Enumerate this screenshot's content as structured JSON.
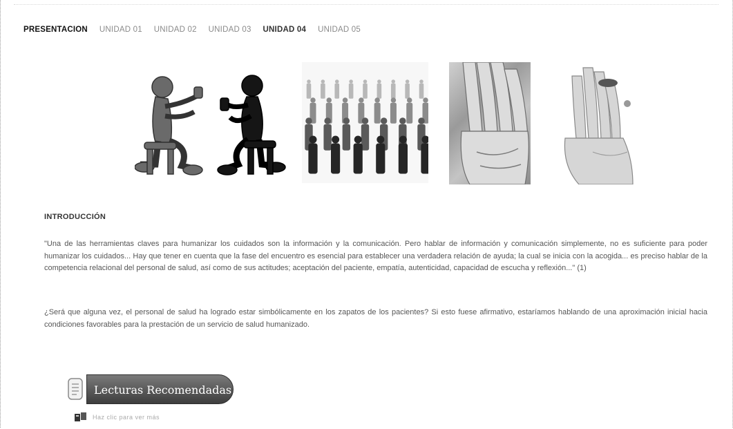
{
  "tabs": [
    {
      "label": "PRESENTACION"
    },
    {
      "label": "UNIDAD 01"
    },
    {
      "label": "UNIDAD 02"
    },
    {
      "label": "UNIDAD 03"
    },
    {
      "label": "UNIDAD 04"
    },
    {
      "label": "UNIDAD 05"
    }
  ],
  "intro": {
    "heading": "INTRODUCCIÓN",
    "paragraph1": "\"Una de las herramientas claves para humanizar los cuidados son la información y la comunicación. Pero hablar de información y comunicación simplemente, no es suficiente para poder humanizar los cuidados... Hay que tener en cuenta que la fase del encuentro es esencial para establecer una verdadera relación de ayuda; la cual se inicia con la acogida... es preciso hablar de la competencia relacional del personal de salud, así como de sus actitudes; aceptación del paciente, empatía, autenticidad, capacidad de escucha y reflexión...\" (1)",
    "paragraph2": "¿Será que alguna vez, el personal de salud ha logrado estar simbólicamente en los zapatos de los pacientes? Si esto fuese afirmativo, estaríamos hablando de una aproximación inicial hacia condiciones favorables para la prestación de un servicio de salud humanizado."
  },
  "lecturas": {
    "button_label": "Lecturas Recomendadas",
    "link_text": "Haz clic para ver más"
  },
  "images": [
    {
      "icon": "two-figures-talking-illustration"
    },
    {
      "icon": "crowd-silhouettes-image"
    },
    {
      "icon": "hand-photo"
    },
    {
      "icon": "hand-with-ring-photo"
    }
  ]
}
